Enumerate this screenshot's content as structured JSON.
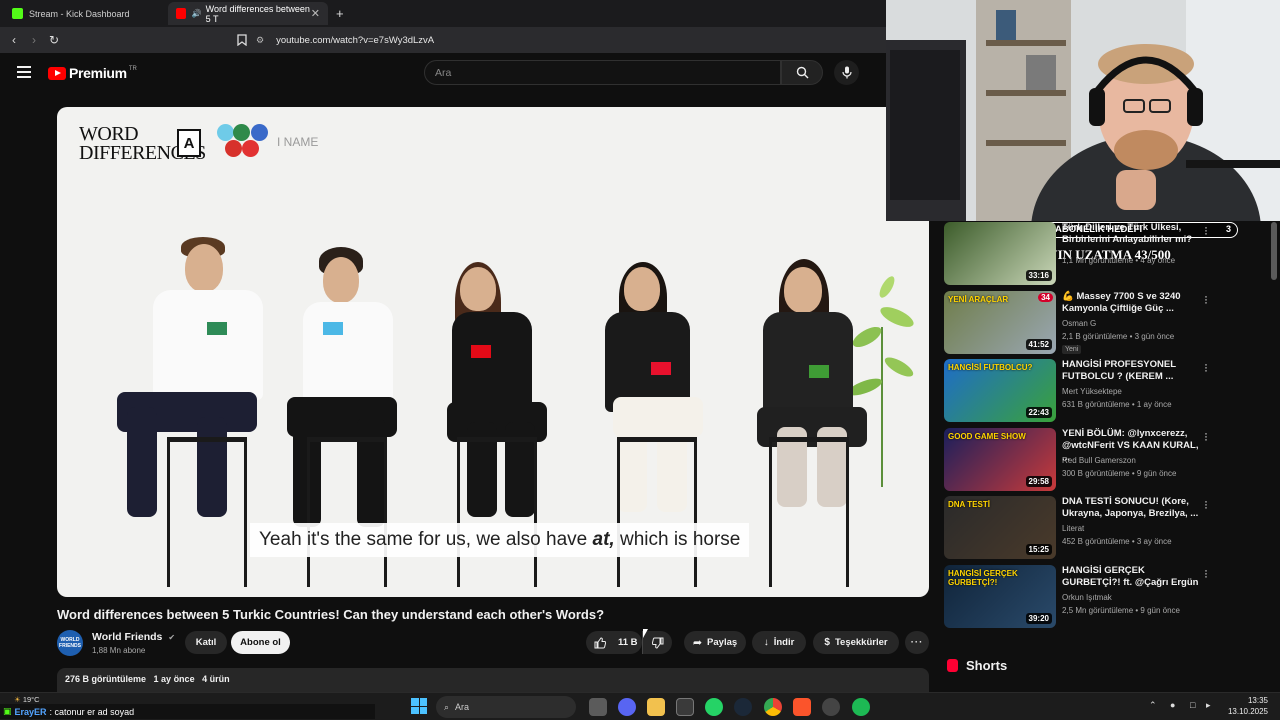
{
  "browser": {
    "tabs": [
      {
        "title": "Stream - Kick Dashboard",
        "active": false
      },
      {
        "title": "Word differences between 5 T",
        "active": true
      }
    ],
    "url": "youtube.com/watch?v=e7sWy3dLzvA"
  },
  "youtube": {
    "logo_text": "Premium",
    "logo_region": "TR",
    "search_placeholder": "Ara"
  },
  "video": {
    "overlay_logo_line1": "WORD",
    "overlay_logo_line2": "DIFFERENCES",
    "overlay_logo_box": "A",
    "overlay_name_label": "I NAME",
    "subtitle_pre": "Yeah it's the same for us, we also have ",
    "subtitle_em": "at,",
    "subtitle_post": " which is horse",
    "title": "Word differences between 5 Turkic Countries! Can they understand each other's Words?",
    "channel_avatar_text": "WORLD FRIENDS",
    "channel": "World Friends",
    "subscribers": "1,88 Mn abone",
    "join_label": "Katıl",
    "subscribe_label": "Abone ol",
    "likes": "11 B",
    "share_label": "Paylaş",
    "download_label": "İndir",
    "thanks_label": "Teşekkürler",
    "views": "276 B görüntüleme",
    "age": "1 ay önce",
    "items": "4 ürün"
  },
  "overlay": {
    "goal_start": "1",
    "goal_label": "ABONELIK HEDEFI",
    "goal_end": "3",
    "goal_progress": 0.33,
    "stream_goal": "AYIN UZATMA 43/500"
  },
  "recommendations": [
    {
      "title": "Türk Dilleri ve Türk Ülkesi, Birbirlerini Anlayabilirler mi?",
      "channel": "",
      "meta": "1,1 Mn görüntüleme • 4 ay önce",
      "duration": "33:16",
      "badge": "",
      "thumb_colors": [
        "#3c5c2a",
        "#c9d6b8"
      ]
    },
    {
      "title": "💪 Massey 7700 S ve 3240 Kamyonla Çiftliğe Güç ...",
      "channel": "Osman G",
      "meta": "2,1 B görüntüleme • 3 gün önce",
      "duration": "41:52",
      "badge": "Yeni",
      "thumb_colors": [
        "#6f7d4a",
        "#9aa7b3"
      ],
      "thumb_text": "YENİ ARAÇLAR",
      "thumb_num": "34"
    },
    {
      "title": "HANGİSİ PROFESYONEL FUTBOLCU ? (KEREM ...",
      "channel": "Mert Yüksektepe",
      "meta": "631 B görüntüleme • 1 ay önce",
      "duration": "22:43",
      "badge": "",
      "thumb_colors": [
        "#1e6cc9",
        "#3aa23a"
      ],
      "thumb_text": "HANGİSİ FUTBOLCU?"
    },
    {
      "title": "YENİ BÖLÜM: @lynxcerezz, @wtcNFerit VS KAAN KURAL, ...",
      "channel": "Red Bull Gamerszon",
      "meta": "300 B görüntüleme • 9 gün önce",
      "duration": "29:58",
      "badge": "",
      "thumb_colors": [
        "#1a1f5c",
        "#c93a3a"
      ],
      "thumb_text": "GOOD GAME SHOW"
    },
    {
      "title": "DNA TESTİ SONUCU! (Kore, Ukrayna, Japonya, Brezilya, ...",
      "channel": "Literat",
      "meta": "452 B görüntüleme • 3 ay önce",
      "duration": "15:25",
      "badge": "",
      "thumb_colors": [
        "#2a2a2a",
        "#4a3a2a"
      ],
      "thumb_text": "DNA TESTİ"
    },
    {
      "title": "HANGİSİ GERÇEK GURBETÇİ?! ft. @Çağrı Ergün",
      "channel": "Orkun Işıtmak",
      "meta": "2,5 Mn görüntüleme • 9 gün önce",
      "duration": "39:20",
      "badge": "",
      "thumb_colors": [
        "#10243a",
        "#2a4a6a"
      ],
      "thumb_text": "HANGİSİ GERÇEK GURBETÇİ?!"
    }
  ],
  "shorts_label": "Shorts",
  "taskbar": {
    "weather": "19°C",
    "chat_user": "ErayER",
    "chat_message": ": catonur er ad soyad",
    "search_placeholder": "Ara",
    "time": "13:35",
    "date": "13.10.2025"
  }
}
